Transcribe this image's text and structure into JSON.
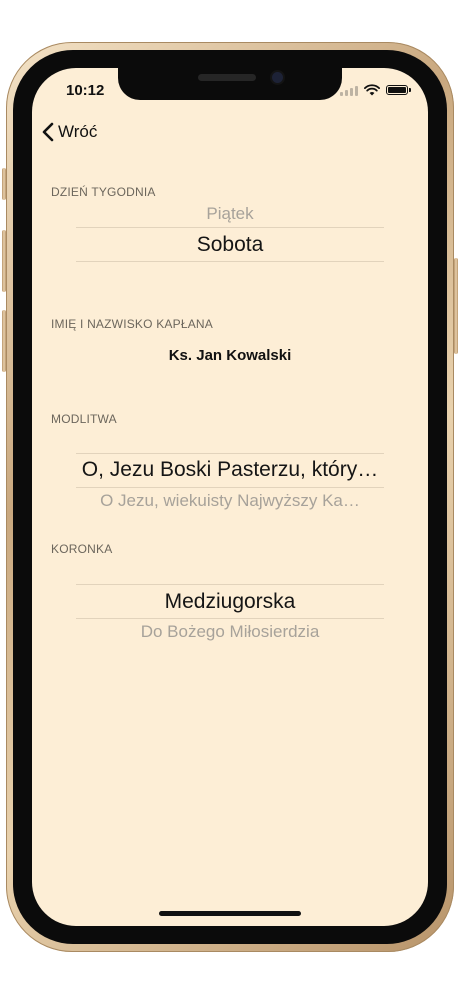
{
  "status_bar": {
    "time": "10:12"
  },
  "nav": {
    "back_label": "Wróć"
  },
  "day_of_week": {
    "label": "DZIEŃ TYGODNIA",
    "above": "Piątek",
    "selected": "Sobota"
  },
  "priest": {
    "label": "IMIĘ I NAZWISKO KAPŁANA",
    "value": "Ks. Jan Kowalski"
  },
  "prayer": {
    "label": "MODLITWA",
    "selected": "O, Jezu Boski Pasterzu, który…",
    "below": "O Jezu, wiekuisty Najwyższy Ka…"
  },
  "chaplet": {
    "label": "KORONKA",
    "selected": "Medziugorska",
    "below": "Do Bożego Miłosierdzia"
  },
  "colors": {
    "screen_background": "#fdeed6",
    "frame": "#c9a87f"
  }
}
